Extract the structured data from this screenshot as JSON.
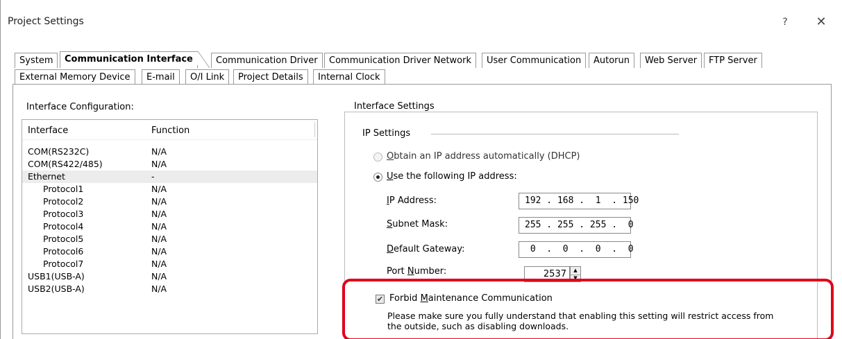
{
  "window": {
    "title": "Project Settings",
    "help_label": "?",
    "close_label": "✕"
  },
  "tabs_row1": [
    {
      "label": "System"
    },
    {
      "label": "Communication Interface",
      "active": true
    },
    {
      "label": "Communication Driver"
    },
    {
      "label": "Communication Driver Network"
    },
    {
      "label": "User Communication"
    },
    {
      "label": "Autorun"
    },
    {
      "label": "Web Server"
    },
    {
      "label": "FTP Server"
    }
  ],
  "tabs_row2": [
    {
      "label": "External Memory Device"
    },
    {
      "label": "E-mail"
    },
    {
      "label": "O/I Link"
    },
    {
      "label": "Project Details"
    },
    {
      "label": "Internal Clock"
    }
  ],
  "interface_config": {
    "title": "Interface Configuration:",
    "columns": [
      "Interface",
      "Function"
    ],
    "rows": [
      {
        "interface": "COM(RS232C)",
        "function": "N/A"
      },
      {
        "interface": "COM(RS422/485)",
        "function": "N/A"
      },
      {
        "interface": "Ethernet",
        "function": "-"
      },
      {
        "interface": "Protocol1",
        "function": "N/A"
      },
      {
        "interface": "Protocol2",
        "function": "N/A"
      },
      {
        "interface": "Protocol3",
        "function": "N/A"
      },
      {
        "interface": "Protocol4",
        "function": "N/A"
      },
      {
        "interface": "Protocol5",
        "function": "N/A"
      },
      {
        "interface": "Protocol6",
        "function": "N/A"
      },
      {
        "interface": "Protocol7",
        "function": "N/A"
      },
      {
        "interface": "USB1(USB-A)",
        "function": "N/A"
      },
      {
        "interface": "USB2(USB-A)",
        "function": "N/A"
      }
    ]
  },
  "interface_settings": {
    "title": "Interface Settings",
    "ip_settings_label": "IP Settings",
    "dhcp": {
      "key": "O",
      "rest": "btain an IP address automatically (DHCP)",
      "selected": false
    },
    "static": {
      "key": "U",
      "rest": "se the following IP address:",
      "selected": true
    },
    "ip_address": {
      "key": "I",
      "rest": "P Address:",
      "value": "192 . 168 .  1  . 150"
    },
    "subnet_mask": {
      "key": "S",
      "rest": "ubnet Mask:",
      "value": "255 . 255 . 255 .  0"
    },
    "gateway": {
      "key": "D",
      "rest": "efault Gateway:",
      "value": " 0  .  0  .  0  .  0"
    },
    "port": {
      "pre": "Port ",
      "key": "N",
      "rest": "umber:",
      "value": "2537"
    },
    "spin_up": "▲",
    "spin_down": "▼"
  },
  "maintenance": {
    "checked": true,
    "check_mark": "✔",
    "pre": "Forbid ",
    "key": "M",
    "rest": "aintenance Communication",
    "note": "Please make sure you fully understand that enabling this setting will restrict access from the outside, such as disabling downloads.",
    "highlight_color": "#e0001b"
  }
}
